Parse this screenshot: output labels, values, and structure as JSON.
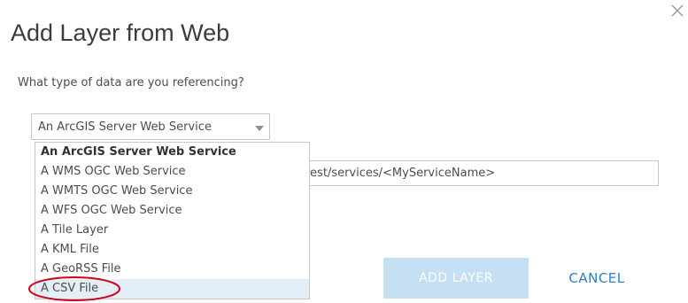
{
  "dialog": {
    "title": "Add Layer from Web",
    "question": "What type of data are you referencing?",
    "close_icon": "close-icon"
  },
  "type_select": {
    "selected": "An ArcGIS Server Web Service",
    "chevron_icon": "chevron-down-icon",
    "options": [
      "An ArcGIS Server Web Service",
      "A WMS OGC Web Service",
      "A WMTS OGC Web Service",
      "A WFS OGC Web Service",
      "A Tile Layer",
      "A KML File",
      "A GeoRSS File",
      "A CSV File"
    ],
    "highlighted_option": "A CSV File"
  },
  "url_field": {
    "visible_text": "rest/services/<MyServiceName>"
  },
  "annotation": {
    "color": "#d0021b",
    "target": "A CSV File"
  },
  "buttons": {
    "add_label": "ADD LAYER",
    "add_disabled": true,
    "cancel_label": "CANCEL"
  },
  "colors": {
    "title": "#3c3c3c",
    "text": "#4c4c4c",
    "border": "#c8c8c8",
    "add_button_bg": "#c5dff3",
    "cancel_text": "#2d7fc5",
    "option_highlight": "#e4eef7"
  }
}
